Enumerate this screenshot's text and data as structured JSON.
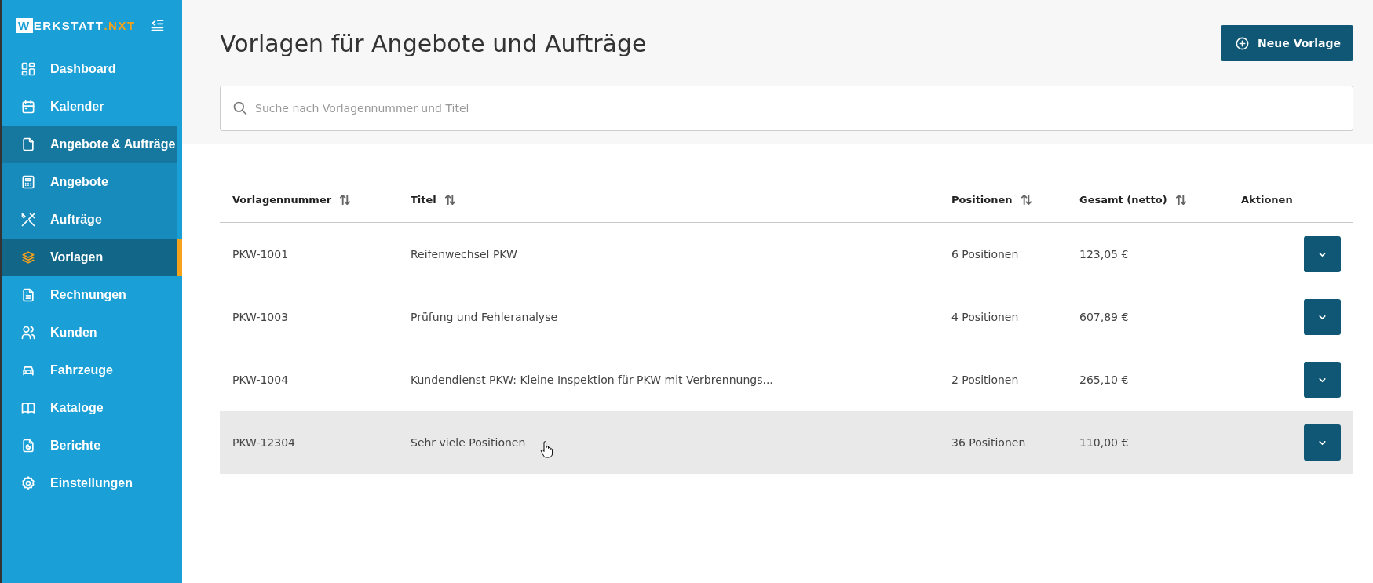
{
  "logo": {
    "initial": "W",
    "name": "ERKSTATT",
    "suffix": ".NXT"
  },
  "sidebar": {
    "items": [
      {
        "label": "Dashboard",
        "selected": false
      },
      {
        "label": "Kalender",
        "selected": false
      },
      {
        "label": "Angebote & Aufträge",
        "selected": false,
        "expanded": true,
        "children": [
          {
            "label": "Angebote",
            "selected": false
          },
          {
            "label": "Aufträge",
            "selected": false
          },
          {
            "label": "Vorlagen",
            "selected": true
          }
        ]
      },
      {
        "label": "Rechnungen",
        "selected": false
      },
      {
        "label": "Kunden",
        "selected": false
      },
      {
        "label": "Fahrzeuge",
        "selected": false
      },
      {
        "label": "Kataloge",
        "selected": false
      },
      {
        "label": "Berichte",
        "selected": false
      },
      {
        "label": "Einstellungen",
        "selected": false
      }
    ]
  },
  "page": {
    "title": "Vorlagen für Angebote und Aufträge",
    "new_button": "Neue Vorlage"
  },
  "search": {
    "placeholder": "Suche nach Vorlagennummer und Titel"
  },
  "table": {
    "columns": [
      {
        "label": "Vorlagennummer",
        "sortable": true
      },
      {
        "label": "Titel",
        "sortable": true
      },
      {
        "label": "Positionen",
        "sortable": true
      },
      {
        "label": "Gesamt (netto)",
        "sortable": true
      },
      {
        "label": "Aktionen",
        "sortable": false
      }
    ],
    "rows": [
      {
        "number": "PKW-1001",
        "title": "Reifenwechsel PKW",
        "positions": "6 Positionen",
        "total": "123,05 €",
        "highlighted": false
      },
      {
        "number": "PKW-1003",
        "title": "Prüfung und Fehleranalyse",
        "positions": "4 Positionen",
        "total": "607,89 €",
        "highlighted": false
      },
      {
        "number": "PKW-1004",
        "title": "Kundendienst PKW: Kleine Inspektion für PKW mit Verbrennungs...",
        "positions": "2 Positionen",
        "total": "265,10 €",
        "highlighted": false
      },
      {
        "number": "PKW-12304",
        "title": "Sehr viele Positionen",
        "positions": "36 Positionen",
        "total": "110,00 €",
        "highlighted": true
      }
    ]
  }
}
